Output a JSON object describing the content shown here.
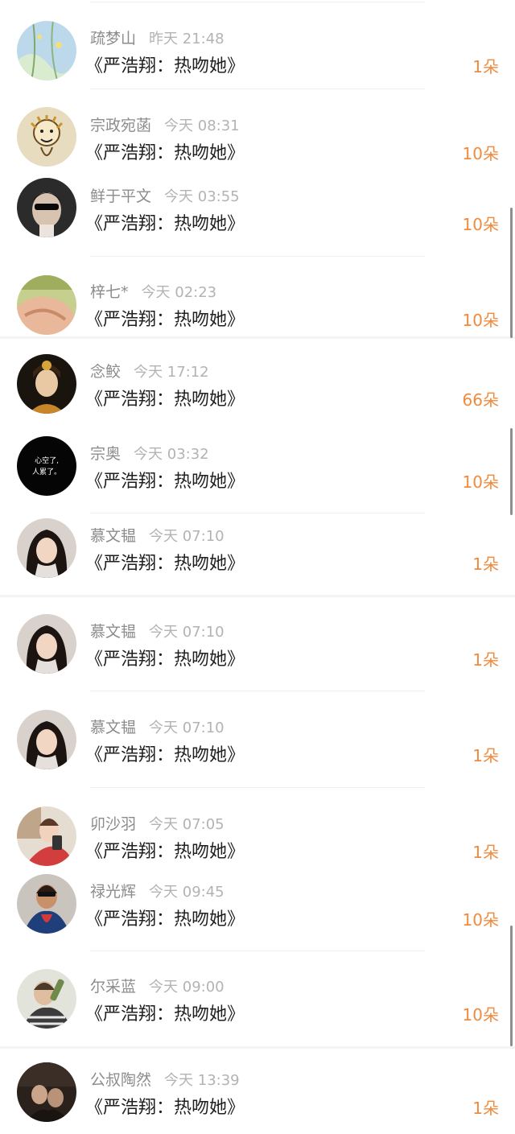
{
  "book_title": "《严浩翔：热吻她》",
  "entries": [
    {
      "name": "疏梦山",
      "time": "昨天 21:48",
      "count": "1朵"
    },
    {
      "name": "宗政宛菡",
      "time": "今天 08:31",
      "count": "10朵"
    },
    {
      "name": "鲜于平文",
      "time": "今天 03:55",
      "count": "10朵"
    },
    {
      "name": "梓七*",
      "time": "今天 02:23",
      "count": "10朵"
    },
    {
      "name": "念鲛",
      "time": "今天 17:12",
      "count": "66朵"
    },
    {
      "name": "宗奥",
      "time": "今天 03:32",
      "count": "10朵"
    },
    {
      "name": "慕文韫",
      "time": "今天 07:10",
      "count": "1朵"
    },
    {
      "name": "慕文韫",
      "time": "今天 07:10",
      "count": "1朵"
    },
    {
      "name": "慕文韫",
      "time": "今天 07:10",
      "count": "1朵"
    },
    {
      "name": "卯沙羽",
      "time": "今天 07:05",
      "count": "1朵"
    },
    {
      "name": "禄光辉",
      "time": "今天 09:45",
      "count": "10朵"
    },
    {
      "name": "尔采蓝",
      "time": "今天 09:00",
      "count": "10朵"
    },
    {
      "name": "公叔陶然",
      "time": "今天 13:39",
      "count": "1朵"
    }
  ],
  "avatar_text": {
    "line1": "心空了,",
    "line2": "人累了。"
  },
  "colors": {
    "count": "#f08a3c",
    "name": "#8c8c8c",
    "time": "#b3b3b3",
    "title": "#1f1f1f"
  }
}
